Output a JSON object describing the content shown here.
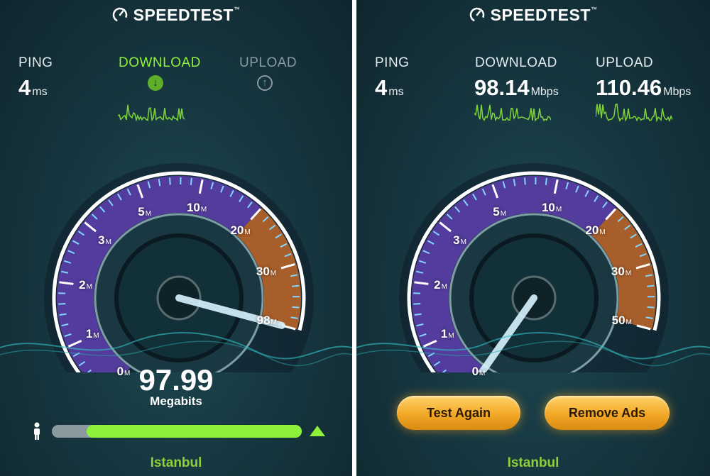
{
  "app": {
    "logo_text": "SPEEDTEST",
    "trademark": "™"
  },
  "colors": {
    "accent_green": "#8ff03a",
    "city_green": "#8fd13a",
    "gauge_purple": "#6a4ab0",
    "gauge_orange": "#c86a28",
    "button_gold": "#f2a826"
  },
  "left_panel": {
    "ping": {
      "label": "PING",
      "value": "4",
      "unit": "ms"
    },
    "download": {
      "label": "DOWNLOAD",
      "icon": "arrow-down-icon",
      "state": "active"
    },
    "upload": {
      "label": "UPLOAD",
      "icon": "arrow-up-icon",
      "state": "inactive"
    },
    "gauge": {
      "tick_labels": [
        {
          "value": "0",
          "suffix": "M"
        },
        {
          "value": "1",
          "suffix": "M"
        },
        {
          "value": "2",
          "suffix": "M"
        },
        {
          "value": "3",
          "suffix": "M"
        },
        {
          "value": "5",
          "suffix": "M"
        },
        {
          "value": "10",
          "suffix": "M"
        },
        {
          "value": "20",
          "suffix": "M"
        },
        {
          "value": "30",
          "suffix": "M"
        },
        {
          "value": "98",
          "suffix": "M"
        }
      ],
      "needle_fraction": 1.0
    },
    "reading": {
      "value": "97.99",
      "unit": "Megabits"
    },
    "progress": {
      "start_fraction": 0.14,
      "end_fraction": 1.0
    },
    "city": "Istanbul"
  },
  "right_panel": {
    "ping": {
      "label": "PING",
      "value": "4",
      "unit": "ms"
    },
    "download": {
      "label": "DOWNLOAD",
      "value": "98.14",
      "unit": "Mbps"
    },
    "upload": {
      "label": "UPLOAD",
      "value": "110.46",
      "unit": "Mbps"
    },
    "gauge": {
      "tick_labels": [
        {
          "value": "0",
          "suffix": "M"
        },
        {
          "value": "1",
          "suffix": "M"
        },
        {
          "value": "2",
          "suffix": "M"
        },
        {
          "value": "3",
          "suffix": "M"
        },
        {
          "value": "5",
          "suffix": "M"
        },
        {
          "value": "10",
          "suffix": "M"
        },
        {
          "value": "20",
          "suffix": "M"
        },
        {
          "value": "30",
          "suffix": "M"
        },
        {
          "value": "50",
          "suffix": "M"
        }
      ],
      "needle_fraction": 0.0
    },
    "buttons": {
      "test_again": "Test Again",
      "remove_ads": "Remove Ads"
    },
    "city": "Istanbul"
  }
}
